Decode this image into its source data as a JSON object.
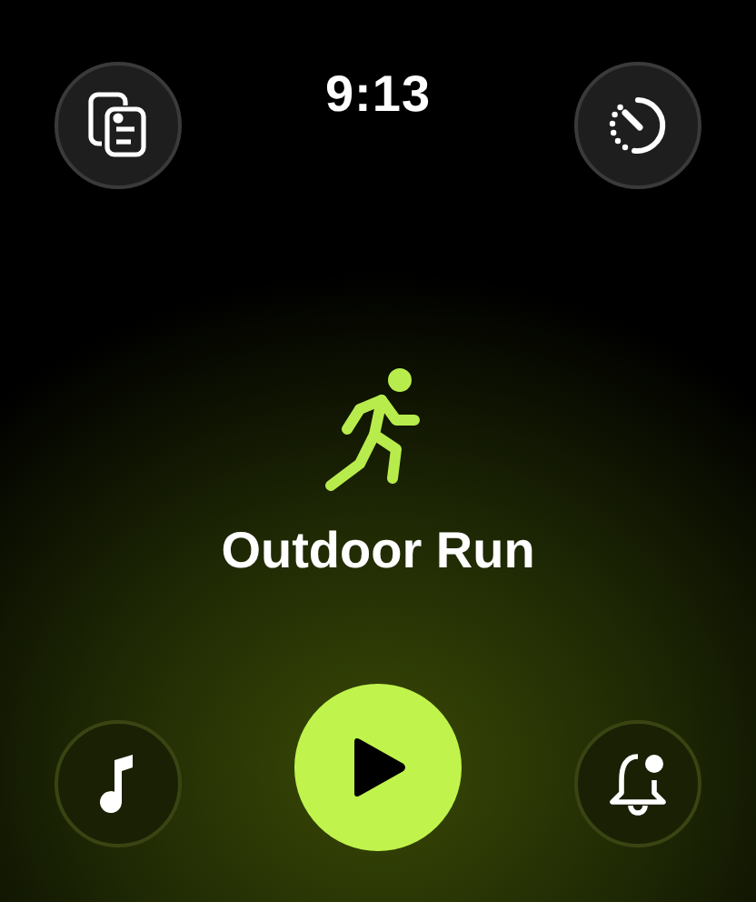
{
  "status_bar": {
    "time": "9:13"
  },
  "workout": {
    "title": "Outdoor Run"
  }
}
